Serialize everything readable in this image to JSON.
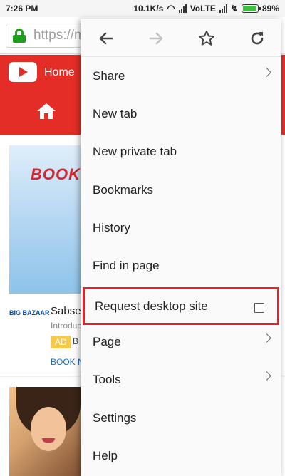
{
  "status": {
    "time": "7:26 PM",
    "speed": "10.1K/s",
    "network": "VoLTE",
    "battery": "89%",
    "battery_level": 0.89
  },
  "urlbar": {
    "url": "https://m"
  },
  "page": {
    "yt_home": "Home",
    "banner_text": "BOOK",
    "advertiser_logo": "BIG BAZAAR",
    "card_title": "Sabse",
    "card_intro": "Introduc",
    "ad_badge": "AD",
    "ad_tag": "B",
    "cta": "BOOK N"
  },
  "menu": {
    "toolbar": {
      "back_icon": "arrow-left",
      "forward_icon": "arrow-right",
      "bookmark_icon": "star",
      "reload_icon": "reload"
    },
    "items": [
      {
        "label": "Share"
      },
      {
        "label": "New tab"
      },
      {
        "label": "New private tab"
      },
      {
        "label": "Bookmarks"
      },
      {
        "label": "History"
      },
      {
        "label": "Find in page"
      },
      {
        "label": "Request desktop site",
        "checked": false
      },
      {
        "label": "Page"
      },
      {
        "label": "Tools"
      },
      {
        "label": "Settings"
      },
      {
        "label": "Help"
      }
    ]
  },
  "colors": {
    "youtube_red": "#e52d27",
    "highlight_red": "#e0232d",
    "lock_green": "#1ea11e"
  }
}
